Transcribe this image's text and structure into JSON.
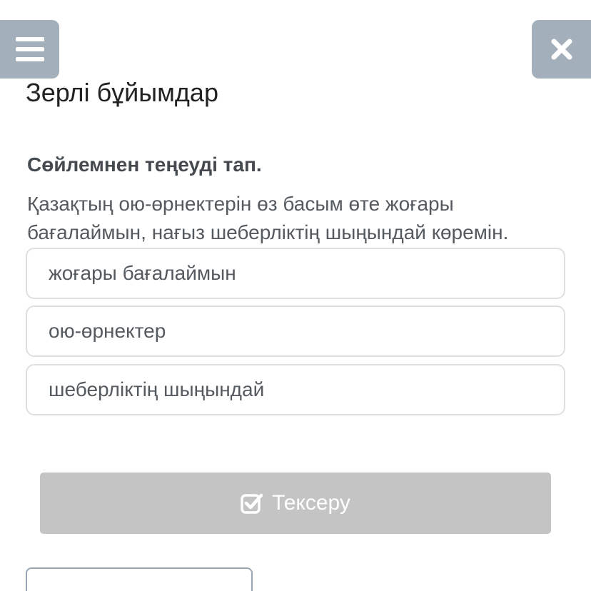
{
  "header": {
    "menu_icon": "hamburger-menu-icon",
    "close_icon": "close-x-icon",
    "accent_color": "#a3b0bb"
  },
  "title": "Зерлі бұйымдар",
  "question": {
    "instruction": "Сөйлемнен теңеуді тап.",
    "sentence": "Қазақтың ою-өрнектерін өз басым өте жоғары бағалаймын, нағыз шеберліктің шыңындай көремін."
  },
  "options": [
    {
      "label": "жоғары бағалаймын"
    },
    {
      "label": "ою-өрнектер"
    },
    {
      "label": "шеберліктің шыңындай"
    }
  ],
  "check_button": {
    "icon": "check-square-icon",
    "label": "Тексеру",
    "color": "#c4c4c4"
  }
}
